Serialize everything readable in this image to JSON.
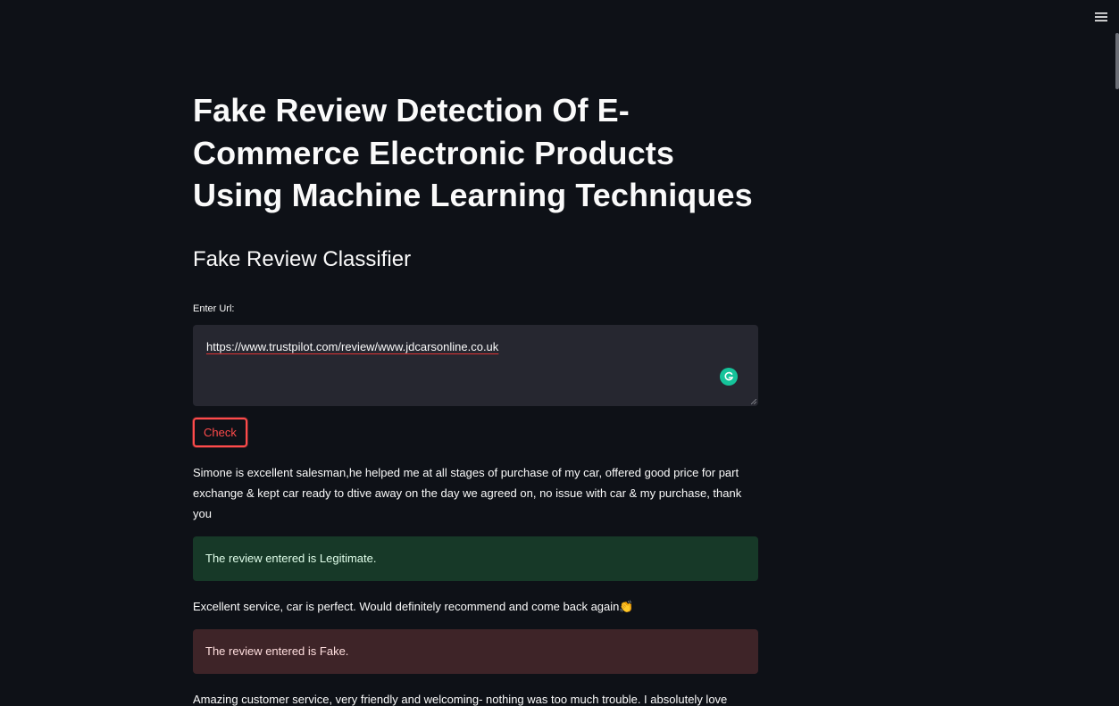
{
  "header": {
    "menu_icon": "hamburger-menu-icon"
  },
  "main": {
    "title": "Fake Review Detection Of E-Commerce Electronic Products Using Machine Learning Techniques",
    "subtitle": "Fake Review Classifier",
    "url_label": "Enter Url:",
    "url_value": "https://www.trustpilot.com/review/www.jdcarsonline.co.uk",
    "check_label": "Check",
    "reviews": [
      {
        "text": "Simone is excellent salesman,he helped me at all stages of purchase of my car, offered good price for part exchange & kept car ready to dtive away on the day we agreed on, no issue with car & my purchase, thank you",
        "result": "The review entered is Legitimate."
      },
      {
        "text": "Excellent service, car is perfect. Would definitely recommend and come back again👏",
        "result": "The review entered is Fake."
      },
      {
        "text": "Amazing customer service, very friendly and welcoming- nothing was too much trouble. I absolutely love",
        "result": ""
      }
    ]
  },
  "colors": {
    "background": "#0e1117",
    "accent": "#ff4b4b",
    "success_bg": "#173928",
    "error_bg": "#3e2428",
    "input_bg": "#262730"
  }
}
